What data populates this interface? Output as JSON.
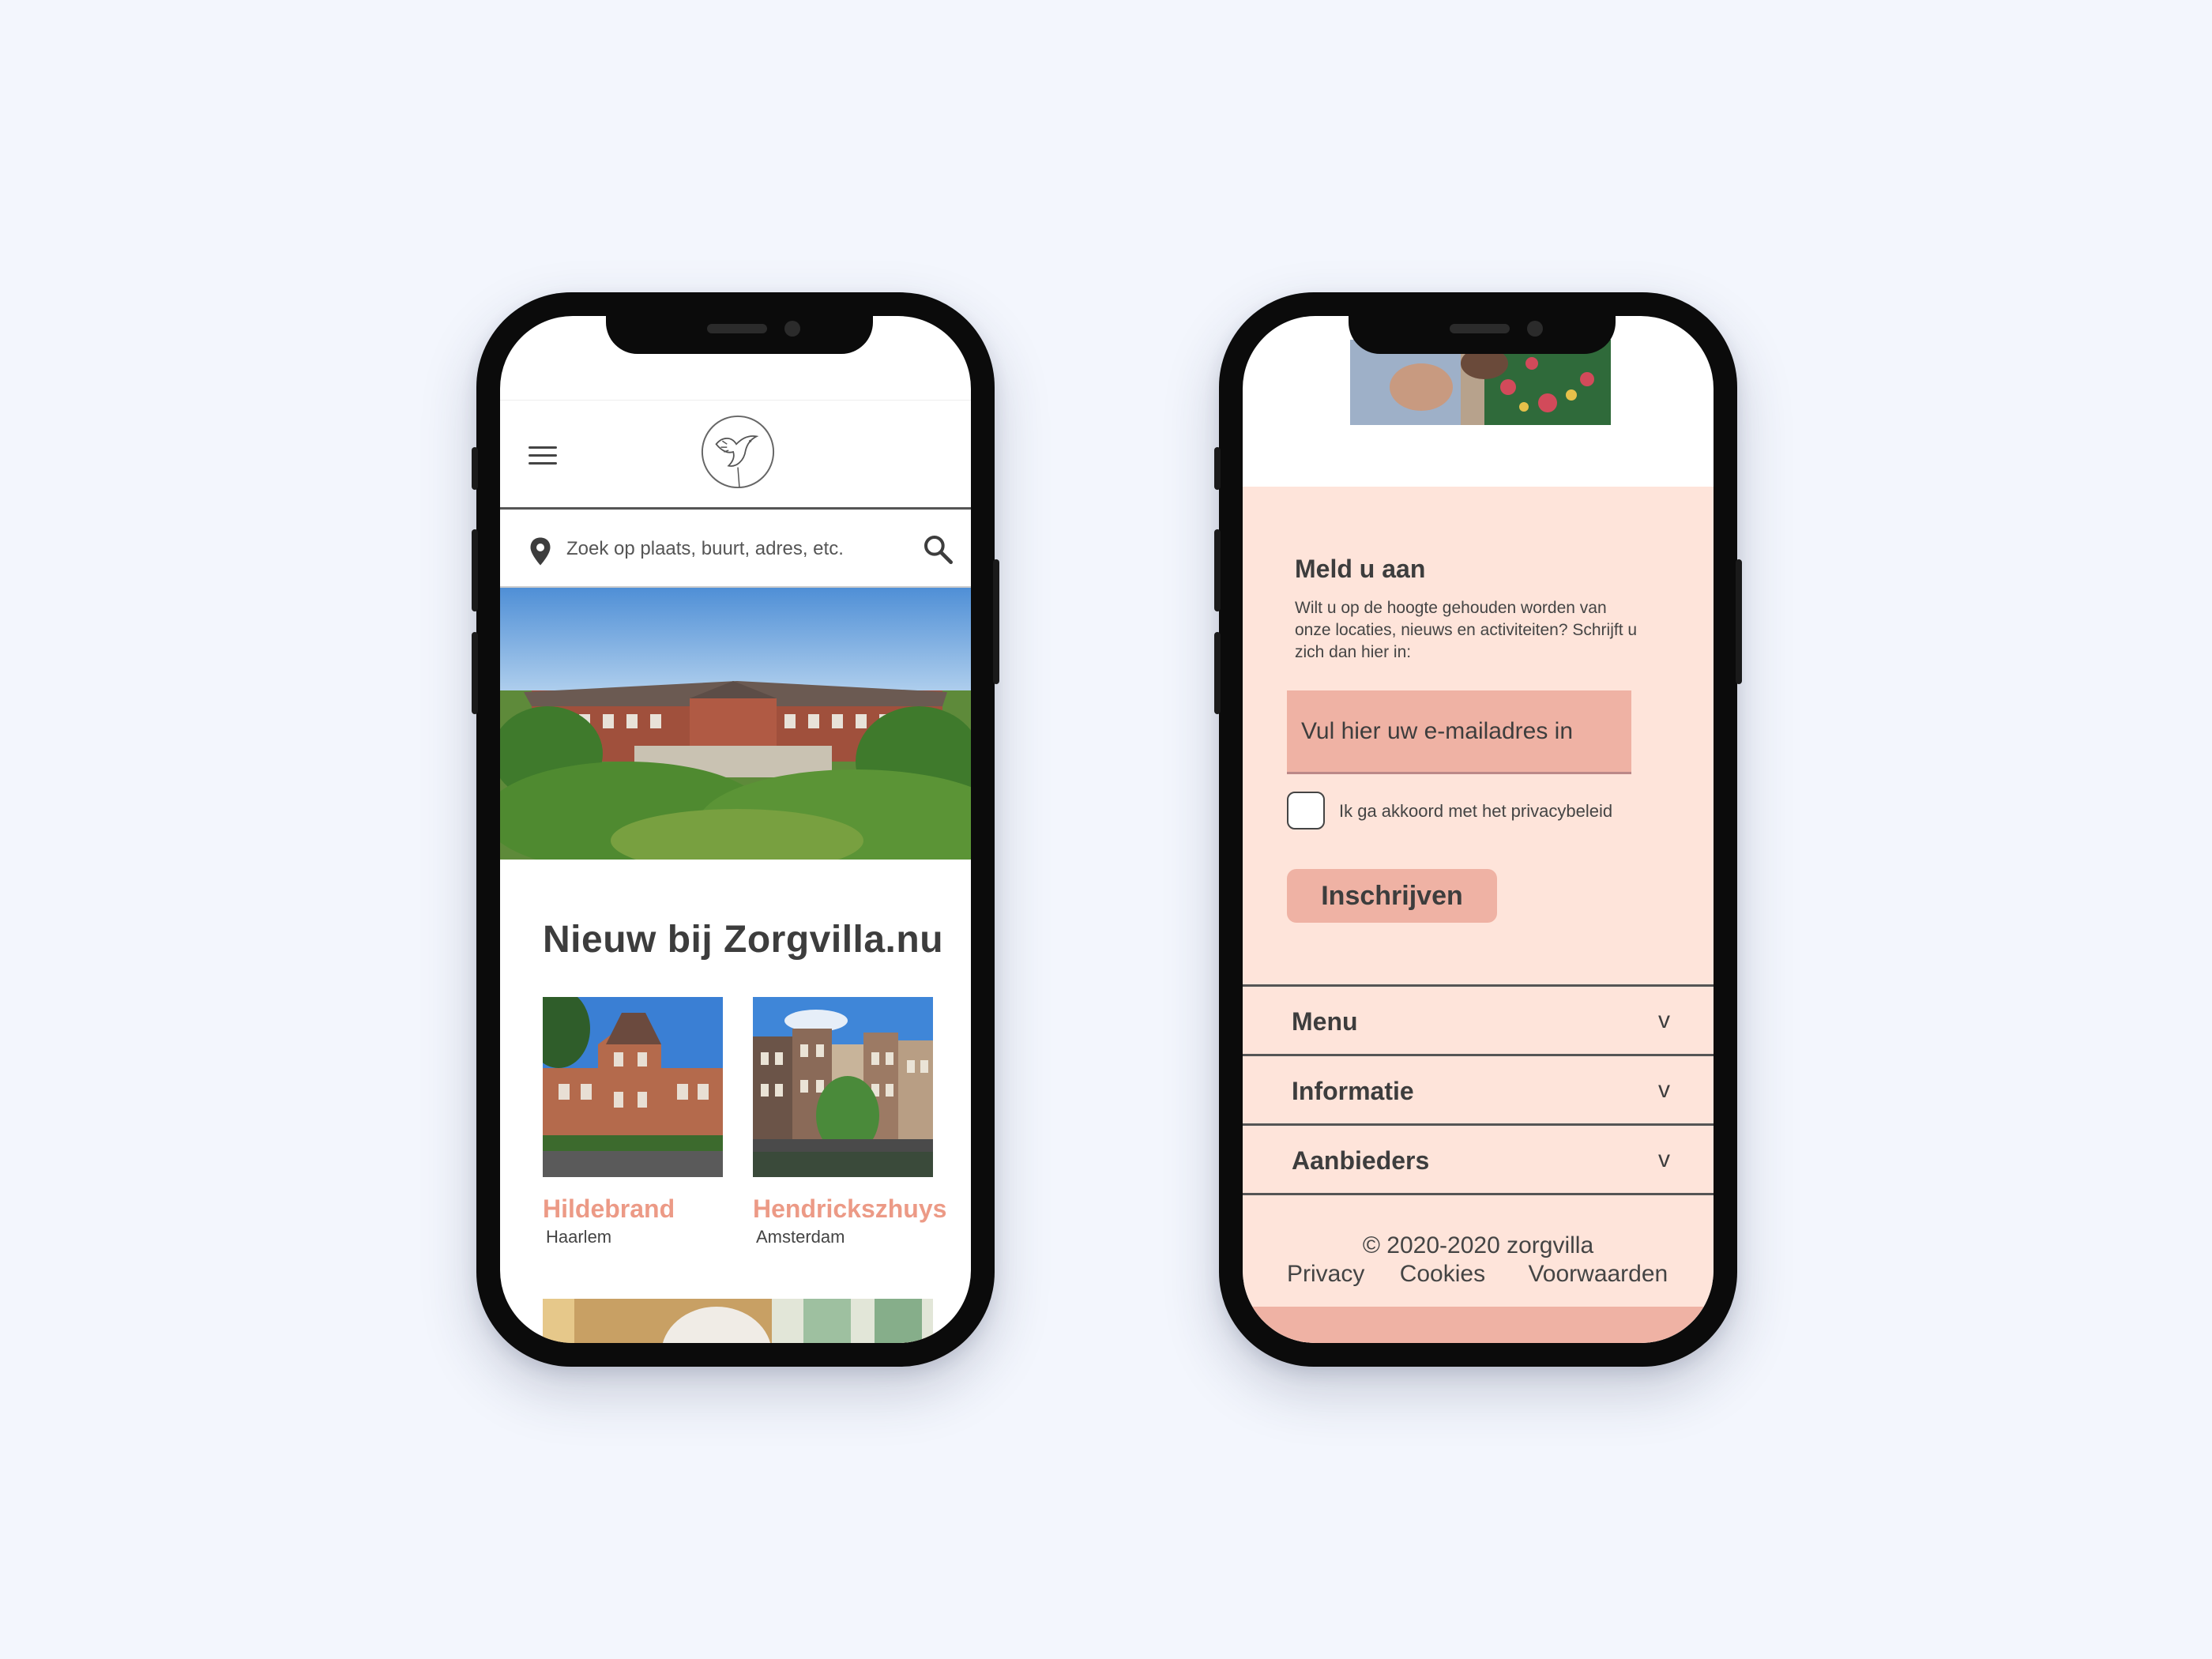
{
  "left_phone": {
    "search": {
      "placeholder": "Zoek op plaats, buurt, adres, etc."
    },
    "section_title": "Nieuw bij Zorgvilla.nu",
    "cards": [
      {
        "name": "Hildebrand",
        "city": "Haarlem"
      },
      {
        "name": "Hendrickszhuys",
        "city": "Amsterdam"
      }
    ]
  },
  "right_phone": {
    "newsletter": {
      "title": "Meld u aan",
      "text": "Wilt u op de hoogte gehouden worden van onze locaties, nieuws en activiteiten? Schrijft u zich dan hier in:",
      "email_placeholder": "Vul hier uw e-mailadres in",
      "consent_label": "Ik ga akkoord met het privacybeleid",
      "submit_label": "Inschrijven"
    },
    "accordion": [
      {
        "label": "Menu",
        "chevron": "v"
      },
      {
        "label": "Informatie",
        "chevron": "v"
      },
      {
        "label": "Aanbieders",
        "chevron": "v"
      }
    ],
    "footer": {
      "copyright": "© 2020-2020 zorgvilla",
      "links": [
        "Privacy",
        "Cookies",
        "Voorwaarden"
      ]
    }
  },
  "colors": {
    "background": "#f3f6fd",
    "accent_pink": "#efb2a4",
    "light_pink": "#fee4da",
    "title_salmon": "#ec9a86",
    "text_dark": "#3d3d3d"
  },
  "icons": [
    "hamburger-icon",
    "dove-logo-icon",
    "location-pin-icon",
    "search-icon",
    "chevron-down-icon"
  ]
}
